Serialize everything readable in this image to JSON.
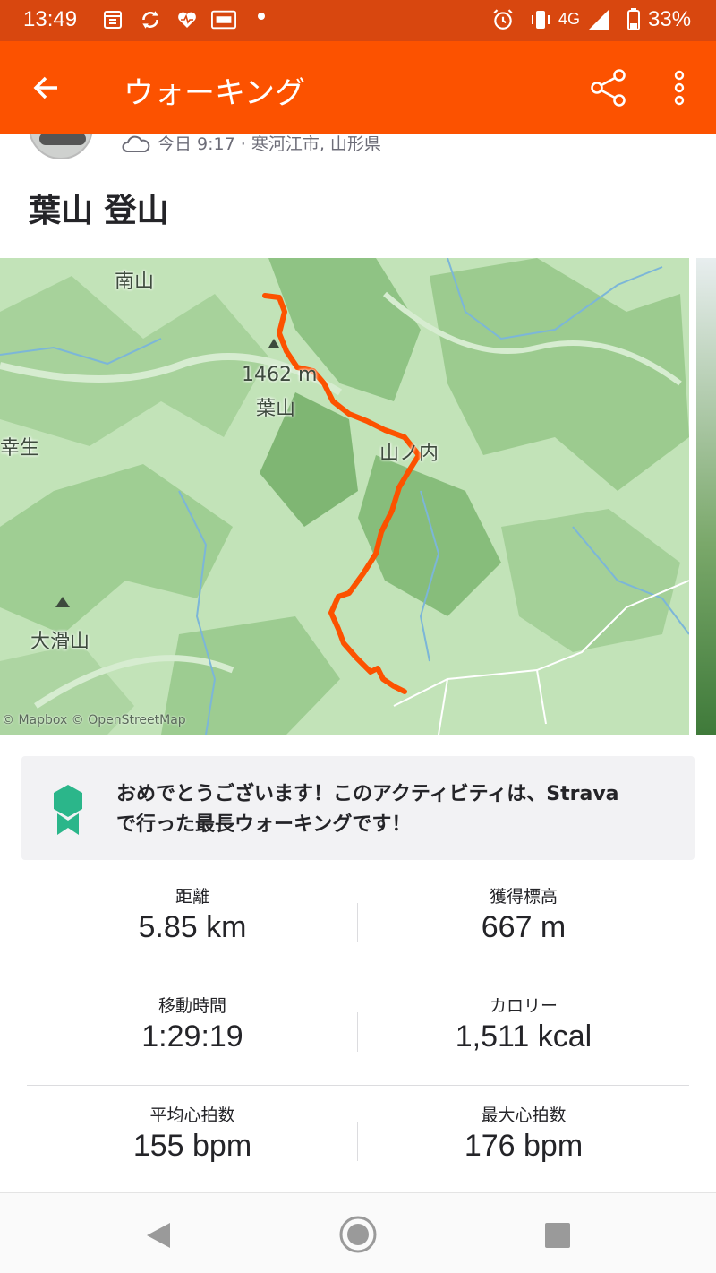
{
  "status_bar": {
    "time": "13:49",
    "network": "4G",
    "battery": "33%",
    "icons": [
      "calendar-icon",
      "sync-icon",
      "heart-icon",
      "app-badge-icon",
      "dot-icon",
      "alarm-icon",
      "vibrate-icon",
      "signal-icon",
      "battery-icon"
    ]
  },
  "app_bar": {
    "title": "ウォーキング",
    "back_icon": "arrow-left-icon",
    "share_icon": "share-icon",
    "more_icon": "more-vert-icon"
  },
  "activity": {
    "meta": "今日 9:17 · 寒河江市, 山形県",
    "title": "葉山 登山"
  },
  "map": {
    "labels": {
      "minamiyama": "南山",
      "summit_elev": "1462 m",
      "hayama": "葉山",
      "yamanouchi": "山ノ内",
      "sachio": "幸生",
      "onameyama": "大滑山"
    },
    "attribution": "© Mapbox © OpenStreetMap",
    "route_color": "#fc5200"
  },
  "achievement": {
    "icon": "award-badge-icon",
    "text_lines": [
      "おめでとうございます！このアクティビティは、Strava",
      "で行った最長ウォーキングです！"
    ]
  },
  "stats": {
    "rows": [
      [
        {
          "label": "距離",
          "value": "5.85 km"
        },
        {
          "label": "獲得標高",
          "value": "667 m"
        }
      ],
      [
        {
          "label": "移動時間",
          "value": "1:29:19"
        },
        {
          "label": "カロリー",
          "value": "1,511 kcal"
        }
      ],
      [
        {
          "label": "平均心拍数",
          "value": "155 bpm"
        },
        {
          "label": "最大心拍数",
          "value": "176 bpm"
        }
      ]
    ]
  },
  "colors": {
    "brand": "#fc5200",
    "status_bar": "#d8470f",
    "achievement_badge": "#2bb68a"
  },
  "nav": {
    "icons": [
      "nav-back-icon",
      "nav-home-icon",
      "nav-recents-icon"
    ]
  }
}
